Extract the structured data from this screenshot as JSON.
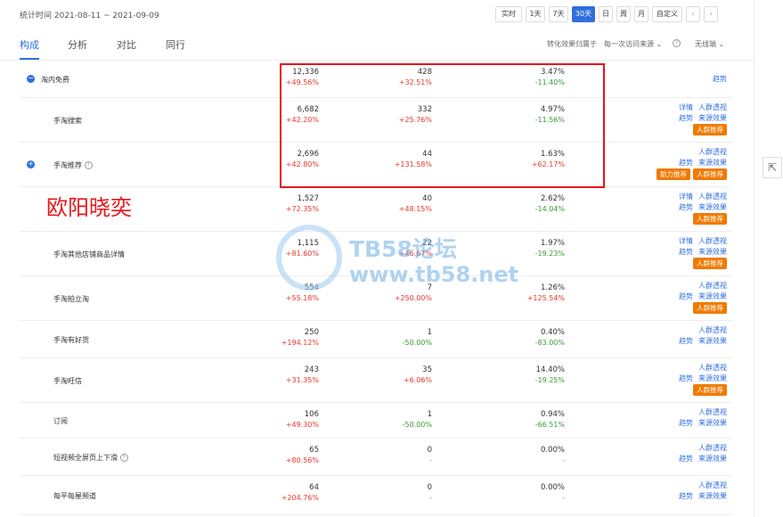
{
  "header": {
    "stat_time": "统计时间 2021-08-11 ~ 2021-09-09",
    "ranges": [
      "实时",
      "1天",
      "7天",
      "30天",
      "日",
      "周",
      "月",
      "自定义"
    ],
    "active_range": "30天",
    "prev": "‹",
    "next": "›"
  },
  "tabs": {
    "items": [
      "构成",
      "分析",
      "对比",
      "同行"
    ],
    "attribution_label": "转化效果归属于",
    "attribution_value": "每一次访问来源",
    "device_value": "无线端"
  },
  "rows": [
    {
      "name": "淘内免费",
      "level": 0,
      "expand": "−",
      "v1": "12,336",
      "p1": "+49.56%",
      "v2": "428",
      "p2": "+32.51%",
      "v3": "3.47%",
      "p3": "-11.40%",
      "links": [
        [
          "趋势"
        ]
      ],
      "tags": []
    },
    {
      "name": "手淘搜索",
      "level": 1,
      "v1": "6,682",
      "p1": "+42.20%",
      "v2": "332",
      "p2": "+25.76%",
      "v3": "4.97%",
      "p3": "-11.56%",
      "links": [
        [
          "详情",
          "人群透视"
        ],
        [
          "趋势",
          "来源效果"
        ]
      ],
      "tags": [
        "人群推荐"
      ]
    },
    {
      "name": "手淘推荐",
      "level": 1,
      "expand": "+",
      "help": true,
      "v1": "2,696",
      "p1": "+42.80%",
      "v2": "44",
      "p2": "+131.58%",
      "v3": "1.63%",
      "p3": "+62.17%",
      "links": [
        [
          "人群透视"
        ],
        [
          "趋势",
          "来源效果"
        ]
      ],
      "tags": [
        "助力推荐",
        "人群推荐"
      ]
    },
    {
      "name": "",
      "level": 1,
      "v1": "1,527",
      "p1": "+72.35%",
      "v2": "40",
      "p2": "+48.15%",
      "v3": "2.62%",
      "p3": "-14.04%",
      "links": [
        [
          "详情",
          "人群透视"
        ],
        [
          "趋势",
          "来源效果"
        ]
      ],
      "tags": [
        "人群推荐"
      ]
    },
    {
      "name": "手淘其他店铺商品详情",
      "level": 1,
      "v1": "1,115",
      "p1": "+81.60%",
      "v2": "22",
      "p2": "+46.67%",
      "v3": "1.97%",
      "p3": "-19.23%",
      "links": [
        [
          "详情",
          "人群透视"
        ],
        [
          "趋势",
          "来源效果"
        ]
      ],
      "tags": [
        "人群推荐"
      ]
    },
    {
      "name": "手淘拍立淘",
      "level": 1,
      "v1": "554",
      "p1": "+55.18%",
      "v2": "7",
      "p2": "+250.00%",
      "v3": "1.26%",
      "p3": "+125.54%",
      "links": [
        [
          "人群透视"
        ],
        [
          "趋势",
          "来源效果"
        ]
      ],
      "tags": [
        "人群推荐"
      ]
    },
    {
      "name": "手淘有好货",
      "level": 1,
      "v1": "250",
      "p1": "+194.12%",
      "v2": "1",
      "p2": "-50.00%",
      "v3": "0.40%",
      "p3": "-83.00%",
      "links": [
        [
          "人群透视"
        ],
        [
          "趋势",
          "来源效果"
        ]
      ],
      "tags": []
    },
    {
      "name": "手淘旺信",
      "level": 1,
      "v1": "243",
      "p1": "+31.35%",
      "v2": "35",
      "p2": "+6.06%",
      "v3": "14.40%",
      "p3": "-19.25%",
      "links": [
        [
          "人群透视"
        ],
        [
          "趋势",
          "来源效果"
        ]
      ],
      "tags": [
        "人群推荐"
      ]
    },
    {
      "name": "订阅",
      "level": 1,
      "v1": "106",
      "p1": "+49.30%",
      "v2": "1",
      "p2": "-50.00%",
      "v3": "0.94%",
      "p3": "-66.51%",
      "links": [
        [
          "人群透视"
        ],
        [
          "趋势",
          "来源效果"
        ]
      ],
      "tags": []
    },
    {
      "name": "短视频全屏页上下滑",
      "level": 1,
      "help": true,
      "v1": "65",
      "p1": "+80.56%",
      "v2": "0",
      "p2": "-",
      "v3": "0.00%",
      "p3": "-",
      "links": [
        [
          "人群透视"
        ],
        [
          "趋势",
          "来源效果"
        ]
      ],
      "tags": []
    },
    {
      "name": "每平每屋频道",
      "level": 1,
      "v1": "64",
      "p1": "+204.76%",
      "v2": "0",
      "p2": "-",
      "v3": "0.00%",
      "p3": "-",
      "links": [
        [
          "人群透视"
        ],
        [
          "趋势",
          "来源效果"
        ]
      ],
      "tags": []
    }
  ],
  "overlay_text": "欧阳晓奕",
  "watermark": {
    "line1": "TB58论坛",
    "line2": "www.tb58.net"
  },
  "scroll_top": "⇱"
}
